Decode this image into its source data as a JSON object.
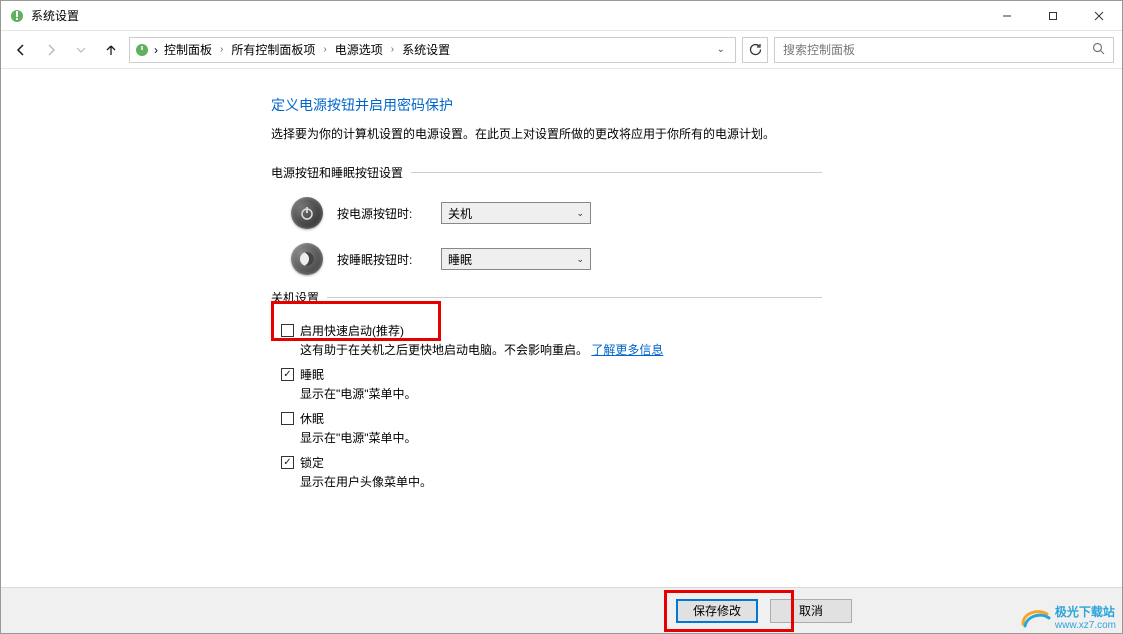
{
  "window": {
    "title": "系统设置"
  },
  "breadcrumb": {
    "items": [
      "控制面板",
      "所有控制面板项",
      "电源选项",
      "系统设置"
    ]
  },
  "search": {
    "placeholder": "搜索控制面板"
  },
  "page": {
    "heading": "定义电源按钮并启用密码保护",
    "desc": "选择要为你的计算机设置的电源设置。在此页上对设置所做的更改将应用于你所有的电源计划。",
    "button_section": "电源按钮和睡眠按钮设置",
    "power_label": "按电源按钮时:",
    "sleep_label": "按睡眠按钮时:",
    "power_value": "关机",
    "sleep_value": "睡眠",
    "shutdown_section": "关机设置",
    "options": [
      {
        "label": "启用快速启动(推荐)",
        "checked": false,
        "desc_a": "这有助于在关机之后更快地启动电脑。不会影响重启。",
        "link": "了解更多信息"
      },
      {
        "label": "睡眠",
        "checked": true,
        "desc_a": "显示在\"电源\"菜单中。"
      },
      {
        "label": "休眠",
        "checked": false,
        "desc_a": "显示在\"电源\"菜单中。"
      },
      {
        "label": "锁定",
        "checked": true,
        "desc_a": "显示在用户头像菜单中。"
      }
    ]
  },
  "footer": {
    "save": "保存修改",
    "cancel": "取消"
  },
  "watermark": {
    "name": "极光下载站",
    "url": "www.xz7.com"
  }
}
